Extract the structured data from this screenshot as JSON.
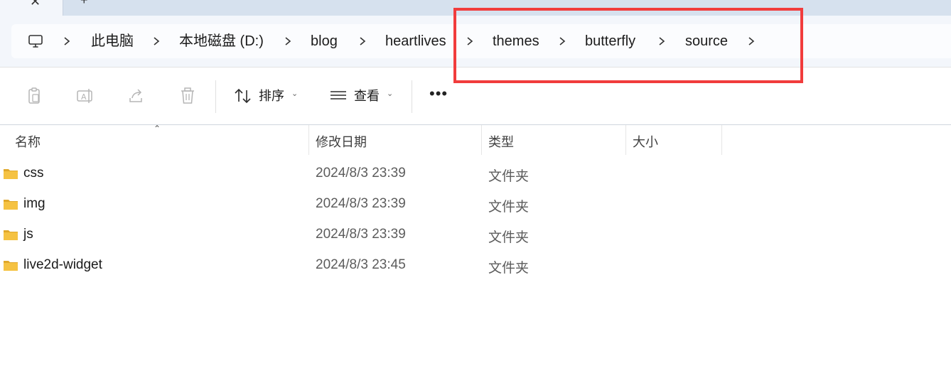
{
  "tabs": {
    "close_glyph": "✕",
    "add_glyph": "+"
  },
  "breadcrumb": {
    "items": [
      "此电脑",
      "本地磁盘 (D:)",
      "blog",
      "heartlives",
      "themes",
      "butterfly",
      "source"
    ],
    "root_icon": "monitor-icon",
    "separator_icon": "chevron-right-icon"
  },
  "highlight": {
    "color": "#f13c3c"
  },
  "toolbar": {
    "copy_icon": "clipboard-icon",
    "rename_icon": "rename-icon",
    "share_icon": "share-icon",
    "delete_icon": "trash-icon",
    "sort_label": "排序",
    "view_label": "查看",
    "more_label": "•••"
  },
  "columns": {
    "name": "名称",
    "modified": "修改日期",
    "type": "类型",
    "size": "大小"
  },
  "files": [
    {
      "name": "css",
      "modified": "2024/8/3 23:39",
      "type": "文件夹"
    },
    {
      "name": "img",
      "modified": "2024/8/3 23:39",
      "type": "文件夹"
    },
    {
      "name": "js",
      "modified": "2024/8/3 23:39",
      "type": "文件夹"
    },
    {
      "name": "live2d-widget",
      "modified": "2024/8/3 23:45",
      "type": "文件夹"
    }
  ],
  "colors": {
    "folder": "#f5c242",
    "folder_dark": "#e0a82a",
    "accent": "#1a73e8"
  }
}
